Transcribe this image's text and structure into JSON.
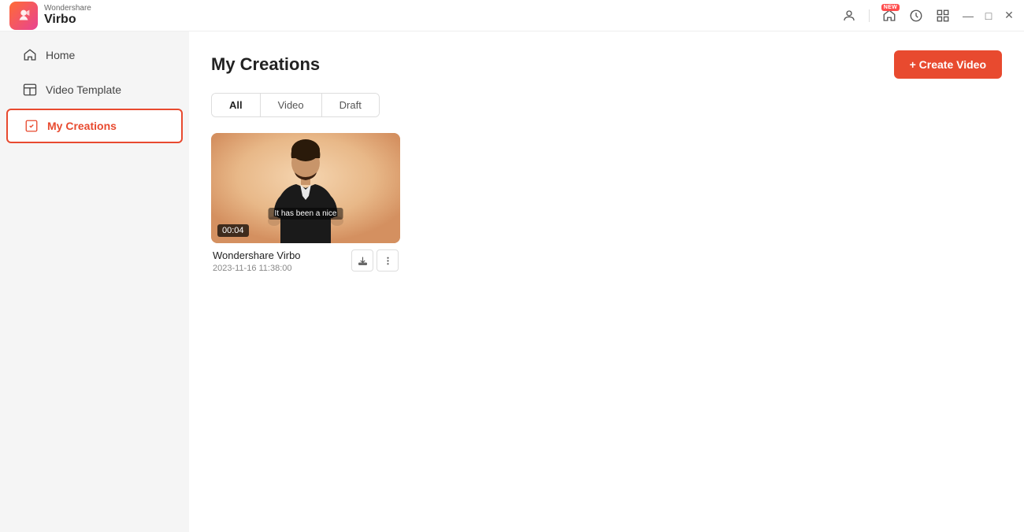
{
  "app": {
    "brand_top": "Wondershare",
    "brand_bottom": "Virbo"
  },
  "titlebar": {
    "icons": {
      "profile": "profile-icon",
      "home": "home-icon",
      "history": "history-icon",
      "grid": "grid-icon",
      "new_badge": "NEW"
    },
    "window_controls": {
      "minimize": "—",
      "maximize": "□",
      "close": "✕"
    }
  },
  "sidebar": {
    "items": [
      {
        "id": "home",
        "label": "Home",
        "icon": "home"
      },
      {
        "id": "video-template",
        "label": "Video Template",
        "icon": "template"
      },
      {
        "id": "my-creations",
        "label": "My Creations",
        "icon": "creations",
        "active": true
      }
    ]
  },
  "content": {
    "page_title": "My Creations",
    "create_btn": "+ Create Video",
    "tabs": [
      {
        "id": "all",
        "label": "All",
        "active": true
      },
      {
        "id": "video",
        "label": "Video",
        "active": false
      },
      {
        "id": "draft",
        "label": "Draft",
        "active": false
      }
    ],
    "videos": [
      {
        "id": "v1",
        "name": "Wondershare Virbo",
        "date": "2023-11-16 11:38:00",
        "duration": "00:04",
        "subtitle": "It has been a nice"
      }
    ]
  }
}
